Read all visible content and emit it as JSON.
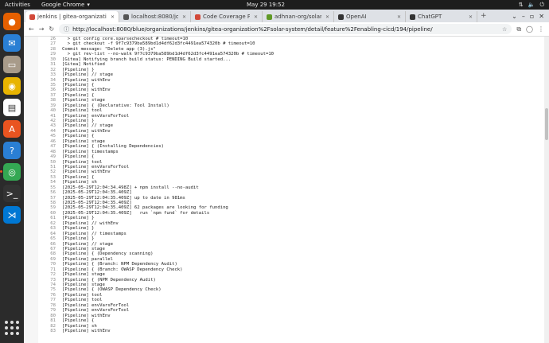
{
  "topbar": {
    "activities": "Activities",
    "app_name": "Google Chrome",
    "clock": "May 29  19:52"
  },
  "dock": {
    "apps": [
      {
        "name": "firefox-icon",
        "color": "#e66000",
        "glyph": "●"
      },
      {
        "name": "thunderbird-icon",
        "color": "#2a7fd4",
        "glyph": "✉"
      },
      {
        "name": "files-icon",
        "color": "#a89b8a",
        "glyph": "▭"
      },
      {
        "name": "rhythmbox-icon",
        "color": "#e8b400",
        "glyph": "◉"
      },
      {
        "name": "libreoffice-writer-icon",
        "color": "#ffffff",
        "glyph": "▤"
      },
      {
        "name": "app-center-icon",
        "color": "#e95420",
        "glyph": "A"
      },
      {
        "name": "help-icon",
        "color": "#2a7fd4",
        "glyph": "?"
      },
      {
        "name": "chrome-icon",
        "color": "#34a853",
        "glyph": "◎"
      },
      {
        "name": "terminal-icon",
        "color": "#333333",
        "glyph": ">_"
      },
      {
        "name": "vscode-icon",
        "color": "#0078d4",
        "glyph": "⋊"
      }
    ]
  },
  "tabs": [
    {
      "label": "jenkins | gitea-organizati",
      "active": true,
      "color": "#d24939"
    },
    {
      "label": "localhost:8080/job/gite",
      "active": false,
      "color": "#555555"
    },
    {
      "label": "Code Coverage Plugin",
      "active": false,
      "color": "#d24939"
    },
    {
      "label": "adhnan-org/solar-syste",
      "active": false,
      "color": "#609926"
    },
    {
      "label": "OpenAI",
      "active": false,
      "color": "#333333"
    },
    {
      "label": "ChatGPT",
      "active": false,
      "color": "#333333"
    }
  ],
  "url": "http://localhost:8080/blue/organizations/jenkins/gitea-organization%2Fsolar-system/detail/feature%2Fenabling-cicd/194/pipeline/",
  "log_lines": [
    {
      "n": "26",
      "t": "  > git config core.sparsecheckout # timeout=10"
    },
    {
      "n": "27",
      "t": "  > git checkout -f 9f7c9379ba589bd1d4df62d3fc4491ea574320b # timeout=10"
    },
    {
      "n": "28",
      "t": "Commit message: \"Delete app (3).js\""
    },
    {
      "n": "29",
      "t": "  > git rev-list --no-walk 9f7c9379ba589bd1d4df62d3fc4491ea574320b # timeout=10"
    },
    {
      "n": "30",
      "t": "[Gitea] Notifying branch build status: PENDING Build started..."
    },
    {
      "n": "31",
      "t": "[Gitea] Notified"
    },
    {
      "n": "32",
      "t": "[Pipeline] }"
    },
    {
      "n": "33",
      "t": "[Pipeline] // stage"
    },
    {
      "n": "34",
      "t": "[Pipeline] withEnv"
    },
    {
      "n": "35",
      "t": "[Pipeline] {"
    },
    {
      "n": "36",
      "t": "[Pipeline] withEnv"
    },
    {
      "n": "37",
      "t": "[Pipeline] {"
    },
    {
      "n": "38",
      "t": "[Pipeline] stage"
    },
    {
      "n": "39",
      "t": "[Pipeline] { (Declarative: Tool Install)"
    },
    {
      "n": "40",
      "t": "[Pipeline] tool"
    },
    {
      "n": "41",
      "t": "[Pipeline] envVarsForTool"
    },
    {
      "n": "42",
      "t": "[Pipeline] }"
    },
    {
      "n": "43",
      "t": "[Pipeline] // stage"
    },
    {
      "n": "44",
      "t": "[Pipeline] withEnv"
    },
    {
      "n": "45",
      "t": "[Pipeline] {"
    },
    {
      "n": "46",
      "t": "[Pipeline] stage"
    },
    {
      "n": "47",
      "t": "[Pipeline] { (Installing Dependencies)"
    },
    {
      "n": "48",
      "t": "[Pipeline] timestamps"
    },
    {
      "n": "49",
      "t": "[Pipeline] {"
    },
    {
      "n": "50",
      "t": "[Pipeline] tool"
    },
    {
      "n": "51",
      "t": "[Pipeline] envVarsForTool"
    },
    {
      "n": "52",
      "t": "[Pipeline] withEnv"
    },
    {
      "n": "53",
      "t": "[Pipeline] {"
    },
    {
      "n": "54",
      "t": "[Pipeline] sh"
    },
    {
      "n": "55",
      "t": "[2025-05-29T12:04:34.498Z] + npm install --no-audit"
    },
    {
      "n": "56",
      "t": "[2025-05-29T12:04:35.409Z]"
    },
    {
      "n": "57",
      "t": "[2025-05-29T12:04:35.409Z] up to date in 981ms"
    },
    {
      "n": "58",
      "t": "[2025-05-29T12:04:35.409Z]"
    },
    {
      "n": "59",
      "t": "[2025-05-29T12:04:35.409Z] 62 packages are looking for funding"
    },
    {
      "n": "60",
      "t": "[2025-05-29T12:04:35.409Z]   run `npm fund` for details"
    },
    {
      "n": "61",
      "t": "[Pipeline] }"
    },
    {
      "n": "62",
      "t": "[Pipeline] // withEnv"
    },
    {
      "n": "63",
      "t": "[Pipeline] }"
    },
    {
      "n": "64",
      "t": "[Pipeline] // timestamps"
    },
    {
      "n": "65",
      "t": "[Pipeline] }"
    },
    {
      "n": "66",
      "t": "[Pipeline] // stage"
    },
    {
      "n": "67",
      "t": "[Pipeline] stage"
    },
    {
      "n": "68",
      "t": "[Pipeline] { (Dependency scanning)"
    },
    {
      "n": "69",
      "t": "[Pipeline] parallel"
    },
    {
      "n": "70",
      "t": "[Pipeline] { (Branch: NPM Dependency Audit)"
    },
    {
      "n": "71",
      "t": "[Pipeline] { (Branch: OWASP Dependency Check)"
    },
    {
      "n": "72",
      "t": "[Pipeline] stage"
    },
    {
      "n": "73",
      "t": "[Pipeline] { (NPM Dependency Audit)"
    },
    {
      "n": "74",
      "t": "[Pipeline] stage"
    },
    {
      "n": "75",
      "t": "[Pipeline] { (OWASP Dependency Check)"
    },
    {
      "n": "76",
      "t": "[Pipeline] tool"
    },
    {
      "n": "77",
      "t": "[Pipeline] tool"
    },
    {
      "n": "78",
      "t": "[Pipeline] envVarsForTool"
    },
    {
      "n": "79",
      "t": "[Pipeline] envVarsForTool"
    },
    {
      "n": "80",
      "t": "[Pipeline] withEnv"
    },
    {
      "n": "81",
      "t": "[Pipeline] {"
    },
    {
      "n": "82",
      "t": "[Pipeline] sh"
    },
    {
      "n": "83",
      "t": "[Pipeline] withEnv"
    }
  ]
}
